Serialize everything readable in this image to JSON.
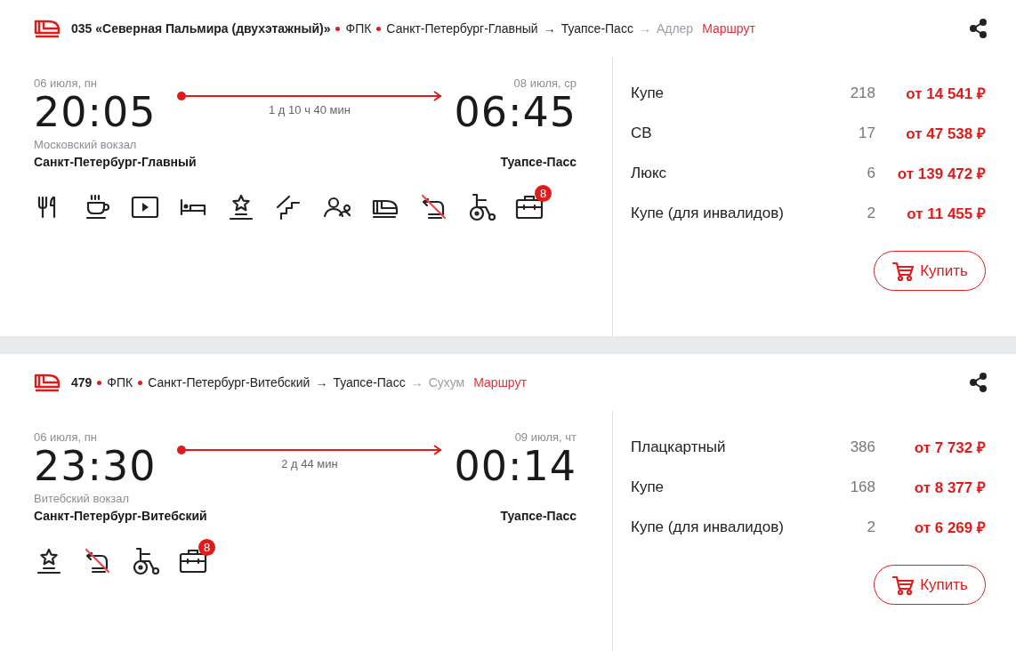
{
  "trains": [
    {
      "number": "035 «Северная Пальмира (двухэтажный)»",
      "carrier": "ФПК",
      "route": {
        "from": "Санкт-Петербург-Главный",
        "arrow_1": "→",
        "to": "Туапсе-Пасс",
        "arrow_2": "→",
        "final": "Адлер"
      },
      "route_link": "Маршрут",
      "departure": {
        "date": "06 июля, пн",
        "time": "20:05",
        "station_note": "Московский вокзал",
        "station": "Санкт-Петербург-Главный"
      },
      "duration": "1 д 10 ч 40 мин",
      "arrival": {
        "date": "08 июля, ср",
        "time": "06:45",
        "station": "Туапсе-Пасс"
      },
      "amenities": [
        {
          "kind": "restaurant"
        },
        {
          "kind": "coffee"
        },
        {
          "kind": "video"
        },
        {
          "kind": "bed"
        },
        {
          "kind": "star"
        },
        {
          "kind": "stairs"
        },
        {
          "kind": "people"
        },
        {
          "kind": "train"
        },
        {
          "kind": "crossed"
        },
        {
          "kind": "wheelchair"
        },
        {
          "kind": "luggage",
          "badge": "8"
        }
      ],
      "classes": [
        {
          "name": "Купе",
          "seats": "218",
          "price": "от 14 541 ₽"
        },
        {
          "name": "СВ",
          "seats": "17",
          "price": "от 47 538 ₽"
        },
        {
          "name": "Люкс",
          "seats": "6",
          "price": "от 139 472 ₽"
        },
        {
          "name": "Купе (для инвалидов)",
          "seats": "2",
          "price": "от 11 455 ₽"
        }
      ],
      "buy": "Купить"
    },
    {
      "number": "479",
      "carrier": "ФПК",
      "route": {
        "from": "Санкт-Петербург-Витебский",
        "arrow_1": "→",
        "to": "Туапсе-Пасс",
        "arrow_2": "→",
        "final": "Сухум"
      },
      "route_link": "Маршрут",
      "departure": {
        "date": "06 июля, пн",
        "time": "23:30",
        "station_note": "Витебский вокзал",
        "station": "Санкт-Петербург-Витебский"
      },
      "duration": "2 д 44 мин",
      "arrival": {
        "date": "09 июля, чт",
        "time": "00:14",
        "station": "Туапсе-Пасс"
      },
      "amenities": [
        {
          "kind": "star"
        },
        {
          "kind": "crossed"
        },
        {
          "kind": "wheelchair"
        },
        {
          "kind": "luggage",
          "badge": "8"
        }
      ],
      "classes": [
        {
          "name": "Плацкартный",
          "seats": "386",
          "price": "от 7 732 ₽"
        },
        {
          "name": "Купе",
          "seats": "168",
          "price": "от 8 377 ₽"
        },
        {
          "name": "Купе (для инвалидов)",
          "seats": "2",
          "price": "от 6 269 ₽"
        }
      ],
      "buy": "Купить"
    }
  ]
}
